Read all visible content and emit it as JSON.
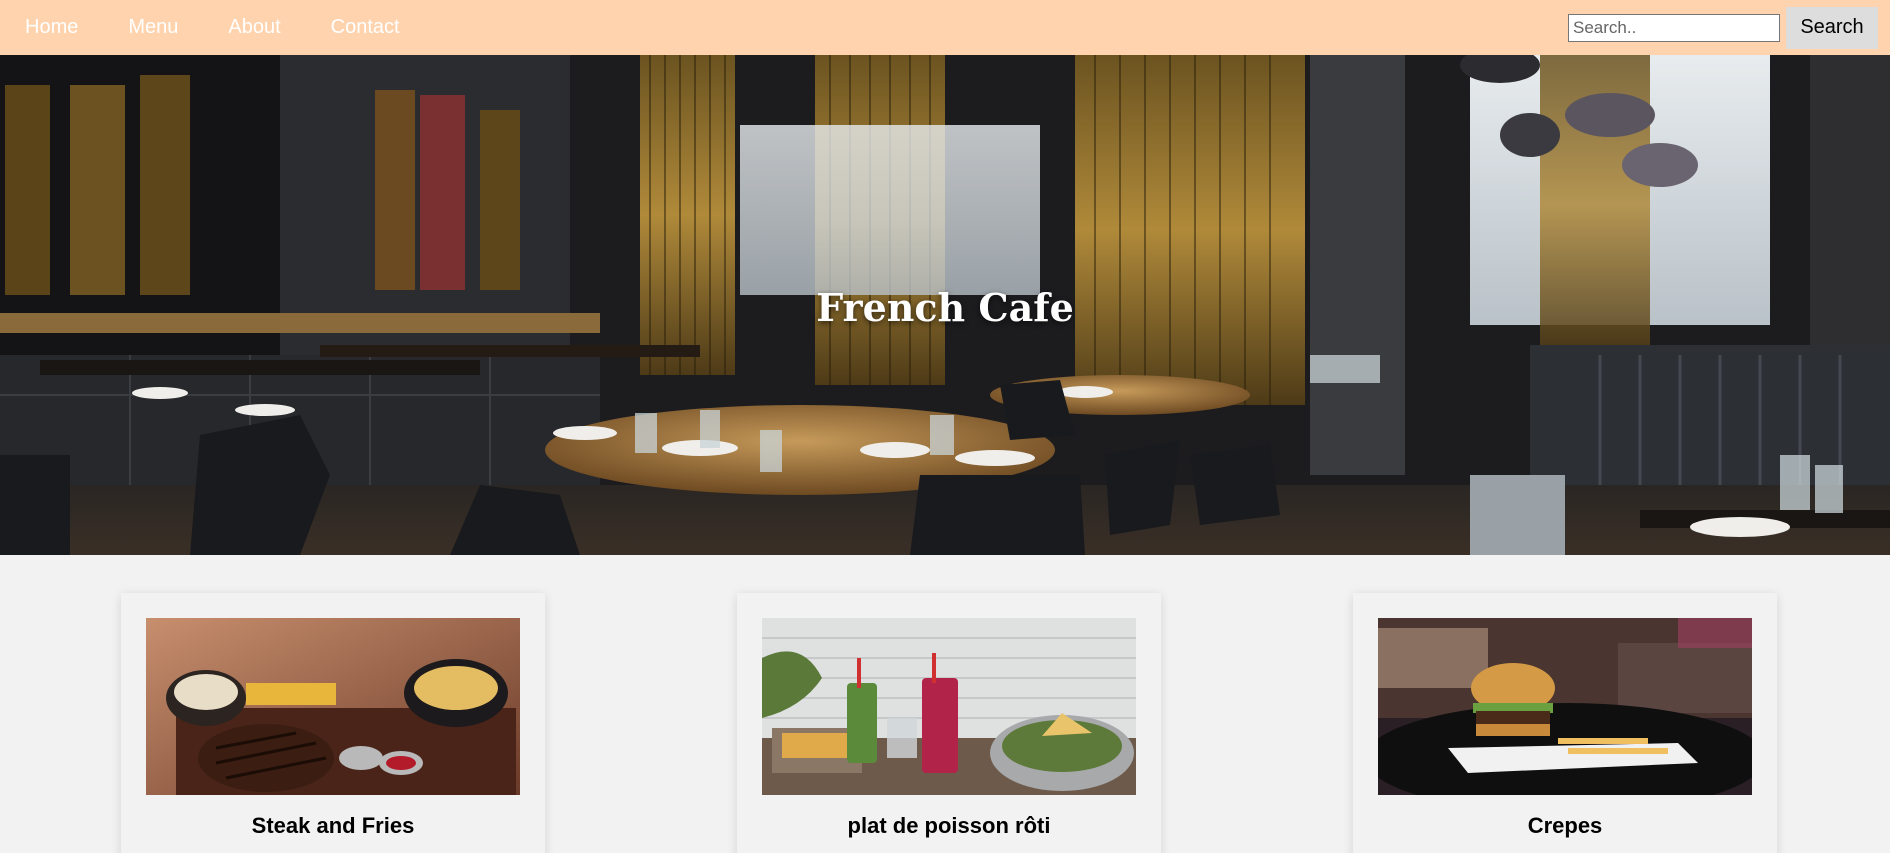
{
  "nav": {
    "links": [
      "Home",
      "Menu",
      "About",
      "Contact"
    ],
    "search_placeholder": "Search..",
    "search_button": "Search"
  },
  "hero": {
    "title": "French Cafe"
  },
  "cards": [
    {
      "title": "Steak and Fries"
    },
    {
      "title": "plat de poisson rôti"
    },
    {
      "title": "Crepes"
    }
  ],
  "colors": {
    "nav_bg": "#ffd3ad",
    "page_bg": "#f2f2f2",
    "search_button_bg": "#dddddd"
  }
}
